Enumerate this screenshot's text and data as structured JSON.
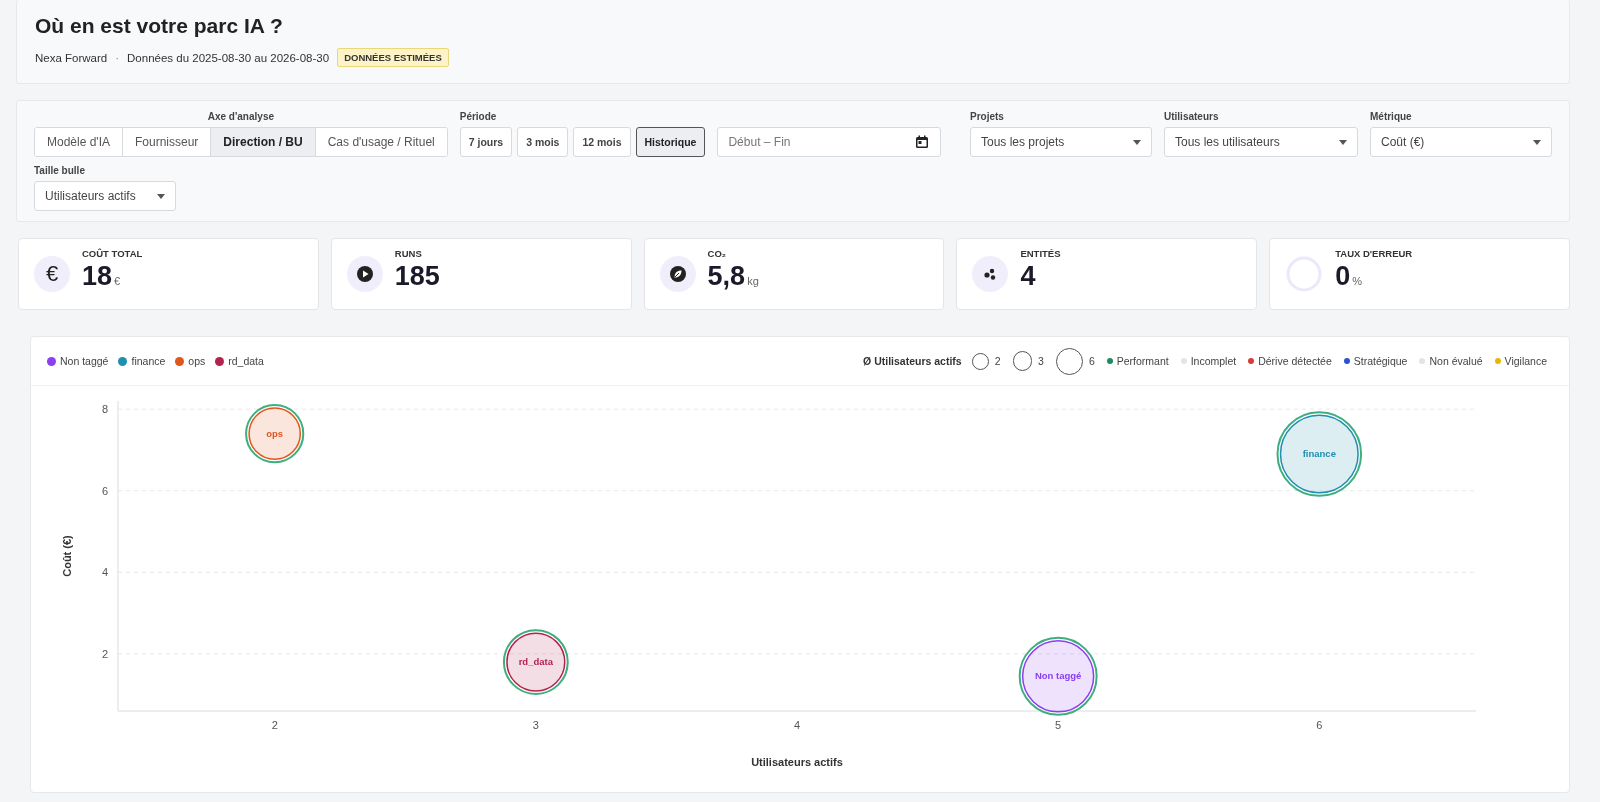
{
  "header": {
    "title": "Où en est votre parc IA ?",
    "org": "Nexa Forward",
    "separator": "·",
    "period": "Données du 2025-08-30 au 2026-08-30",
    "badge": "DONNÉES ESTIMÉES"
  },
  "filters": {
    "axis": {
      "label": "Axe d'analyse",
      "options": [
        {
          "label": "Modèle d'IA",
          "selected": false
        },
        {
          "label": "Fournisseur",
          "selected": false
        },
        {
          "label": "Direction / BU",
          "selected": true
        },
        {
          "label": "Cas d'usage / Rituel",
          "selected": false
        }
      ]
    },
    "period": {
      "label": "Période",
      "options": [
        {
          "label": "7 jours",
          "selected": false
        },
        {
          "label": "3 mois",
          "selected": false
        },
        {
          "label": "12 mois",
          "selected": false
        },
        {
          "label": "Historique",
          "selected": true
        }
      ]
    },
    "date_range": {
      "placeholder": "Début – Fin"
    },
    "selects": [
      {
        "label": "Projets",
        "value": "Tous les projets"
      },
      {
        "label": "Utilisateurs",
        "value": "Tous les utilisateurs"
      },
      {
        "label": "Métrique",
        "value": "Coût (€)"
      }
    ],
    "bubble_size": {
      "label": "Taille bulle",
      "value": "Utilisateurs actifs"
    }
  },
  "kpis": [
    {
      "kind": "symbol",
      "symbol": "€",
      "label": "COÛT TOTAL",
      "value": "18",
      "unit": "€"
    },
    {
      "kind": "play",
      "label": "RUNS",
      "value": "185"
    },
    {
      "kind": "leaf",
      "label": "CO₂",
      "value": "5,8",
      "unit": "kg"
    },
    {
      "kind": "dots",
      "label": "ENTITÉS",
      "value": "4"
    },
    {
      "kind": "gauge",
      "label": "TAUX D'ERREUR",
      "value": "0",
      "unit": "%"
    }
  ],
  "chart": {
    "size_legend": {
      "title": "Ø Utilisateurs actifs",
      "sizes": [
        "2",
        "3",
        "6"
      ]
    },
    "status_legend": [
      {
        "label": "Performant",
        "color": "#1e8a5e"
      },
      {
        "label": "Incomplet",
        "color": "#e2e4e8"
      },
      {
        "label": "Dérive détectée",
        "color": "#d93a3a"
      },
      {
        "label": "Stratégique",
        "color": "#2f4fd6"
      },
      {
        "label": "Non évalué",
        "color": "#e2e4e8"
      },
      {
        "label": "Vigilance",
        "color": "#e6b800"
      }
    ],
    "chart_data": {
      "type": "scatter",
      "xlabel": "Utilisateurs actifs",
      "ylabel": "Coût (€)",
      "xlim": [
        1.4,
        6.6
      ],
      "ylim": [
        0.6,
        8.2
      ],
      "xticks": [
        2,
        3,
        4,
        5,
        6
      ],
      "yticks": [
        2,
        4,
        6,
        8
      ],
      "grid": true,
      "series": [
        {
          "name": "Non taggé",
          "color": "#8a3ff0",
          "x": [
            5
          ],
          "values": [
            1.45
          ]
        },
        {
          "name": "finance",
          "color": "#1e8fb0",
          "x": [
            6
          ],
          "values": [
            6.9
          ]
        },
        {
          "name": "ops",
          "color": "#e0561e",
          "x": [
            2
          ],
          "values": [
            7.4
          ]
        },
        {
          "name": "rd_data",
          "color": "#b3224f",
          "x": [
            3
          ],
          "values": [
            1.8
          ]
        }
      ]
    }
  }
}
